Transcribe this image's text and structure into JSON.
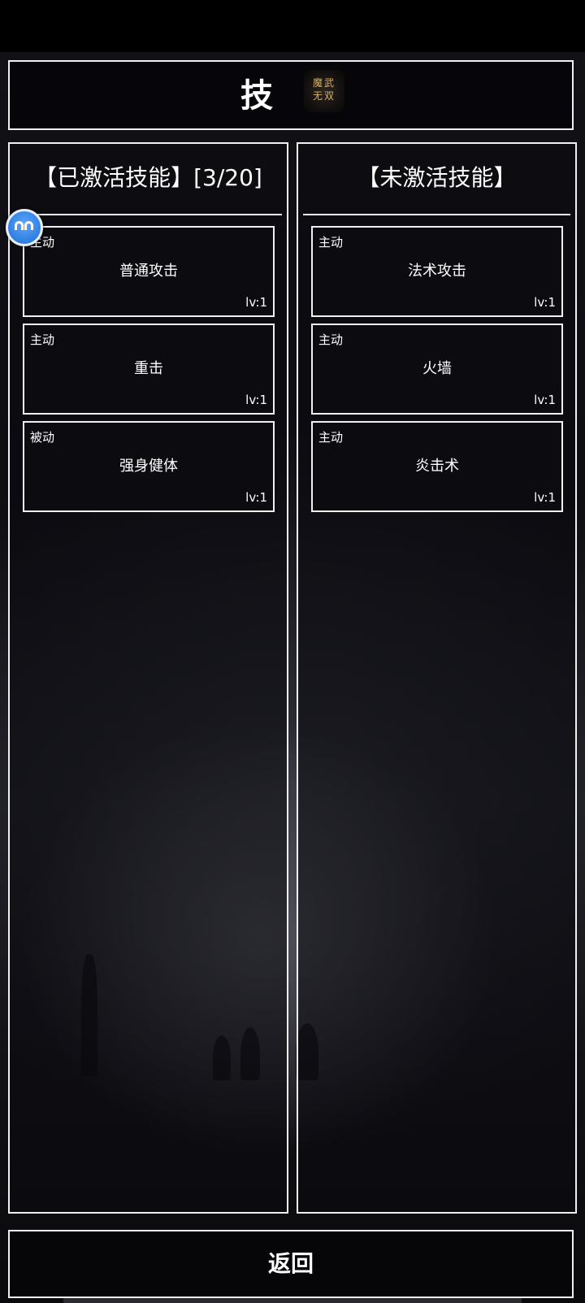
{
  "header": {
    "title": "技",
    "logo_text": "魔武\n无双"
  },
  "activated": {
    "header": "【已激活技能】[3/20]",
    "skills": [
      {
        "type": "主动",
        "name": "普通攻击",
        "level": "lv:1"
      },
      {
        "type": "主动",
        "name": "重击",
        "level": "lv:1"
      },
      {
        "type": "被动",
        "name": "强身健体",
        "level": "lv:1"
      }
    ]
  },
  "inactive": {
    "header": "【未激活技能】",
    "skills": [
      {
        "type": "主动",
        "name": "法术攻击",
        "level": "lv:1"
      },
      {
        "type": "主动",
        "name": "火墙",
        "level": "lv:1"
      },
      {
        "type": "主动",
        "name": "炎击术",
        "level": "lv:1"
      }
    ]
  },
  "footer": {
    "back_label": "返回"
  }
}
